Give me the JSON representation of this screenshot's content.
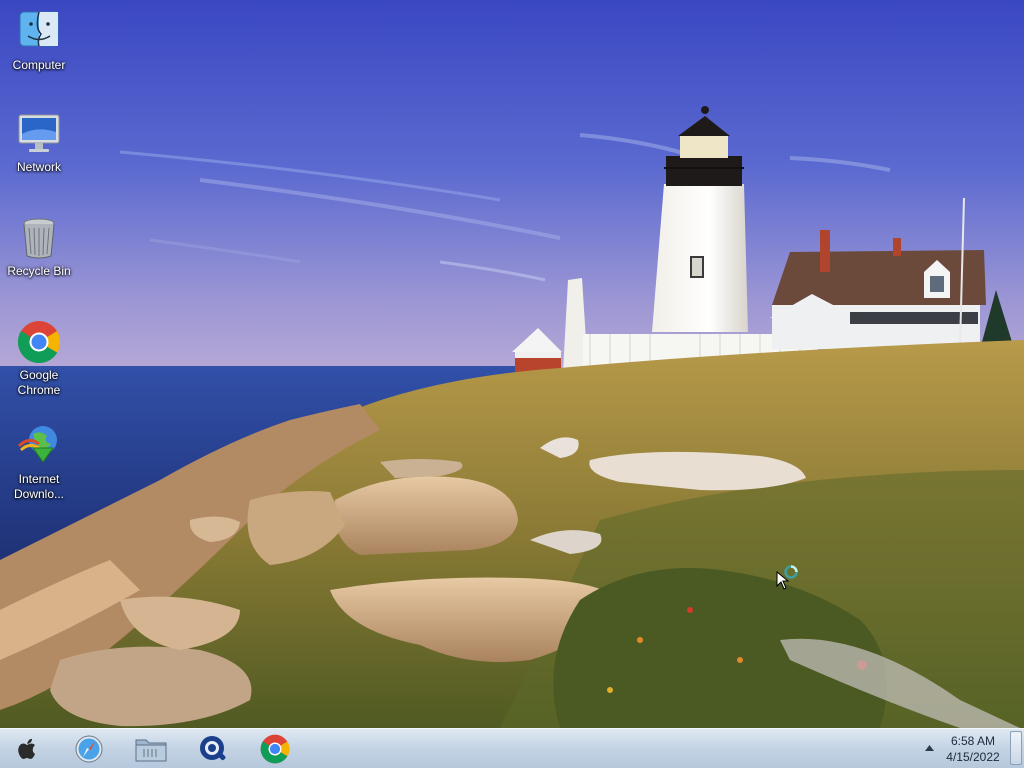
{
  "desktop": {
    "icons": [
      {
        "label": "Computer",
        "icon": "finder-icon"
      },
      {
        "label": "Network",
        "icon": "monitor-icon"
      },
      {
        "label": "Recycle Bin",
        "icon": "trash-icon"
      },
      {
        "label": "Google Chrome",
        "icon": "chrome-icon"
      },
      {
        "label": "Internet Downlo...",
        "icon": "internet-download-manager-icon"
      }
    ]
  },
  "taskbar": {
    "pinned": [
      {
        "icon": "apple-logo-icon"
      },
      {
        "icon": "safari-icon"
      },
      {
        "icon": "folder-icon"
      },
      {
        "icon": "quicktime-icon"
      },
      {
        "icon": "chrome-icon"
      }
    ],
    "clock": {
      "time": "6:58 AM",
      "date": "4/15/2022"
    }
  },
  "colors": {
    "sky_top": "#3f52c8",
    "sky_horizon": "#a79fd6",
    "sea": "#243f8e",
    "taskbar": "#c9d8e8"
  }
}
